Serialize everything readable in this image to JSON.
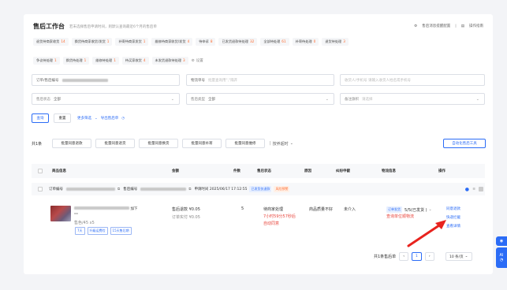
{
  "header": {
    "title": "售后工作台",
    "subtitle": "若未选择售后申请时间，则默认查询最近6个月的售后单",
    "link_config": "售后消息提醒配置",
    "link_guide": "操作指南"
  },
  "status_chips_row1": [
    {
      "label": "退货待商家收货",
      "count": "14"
    },
    {
      "label": "换货待商家收货/发货",
      "count": "1"
    },
    {
      "label": "补寄待商家发货",
      "count": "1"
    },
    {
      "label": "维修待商家收货/发货",
      "count": "4"
    },
    {
      "label": "待申诉",
      "count": "8"
    },
    {
      "label": "已发货退款待处理",
      "count": "32"
    },
    {
      "label": "全部待处理",
      "count": "61"
    },
    {
      "label": "补寄待处理",
      "count": "0"
    },
    {
      "label": "退货待处理",
      "count": "3"
    }
  ],
  "status_chips_row2": [
    {
      "label": "争议待处理",
      "count": "1"
    },
    {
      "label": "换货待处理",
      "count": "1"
    },
    {
      "label": "维修待处理",
      "count": "1"
    },
    {
      "label": "待买家收货",
      "count": "4"
    },
    {
      "label": "未发货退款待处理",
      "count": "3"
    }
  ],
  "settings_label": "设置",
  "filters": {
    "order_no_label": "订单/售后编号",
    "logistics_label": "物流单号",
    "logistics_placeholder": "批量查询用\",\"隔开",
    "buyer_placeholder": "收货人/手机号 请输入收货人姓名或手机号",
    "after_status_label": "售后状态",
    "after_status_value": "全部",
    "after_type_label": "售后类型",
    "after_type_value": "全部",
    "remark_label": "备注旗帜",
    "remark_value": "请选择"
  },
  "actions": {
    "search": "查询",
    "reset": "重置",
    "more_filters": "更多筛选",
    "export": "导出售后单"
  },
  "batch": {
    "total": "共1条",
    "btn1": "批量同意退款",
    "btn2": "批量同意退货",
    "btn3": "批量同意换货",
    "btn4": "批量同意补寄",
    "btn5": "批量同意维修",
    "sort": "按养超时",
    "auto_tool": "自动化售后工具"
  },
  "table_headers": {
    "goods": "商品信息",
    "amount": "金额",
    "qty": "件数",
    "status": "售后状态",
    "reason": "原因",
    "dispute": "纠纷申截",
    "logistics": "物流信息",
    "ops": "操作"
  },
  "order": {
    "order_no_label": "订单编号",
    "after_no_label": "售后编号",
    "apply_time": "申请时间 2025/06/17 17:12:55",
    "tag1": "已发货仅退款",
    "tag2": "风险预警",
    "goods_title_suffix": "加下",
    "goods_spec": "售色/45 x5",
    "goods_tag1": "7天",
    "goods_tag2": "升级运费险",
    "goods_tag3": "15天售后期",
    "refund_amount": "售后退款 ¥0.05",
    "order_amount": "订单实付 ¥0.05",
    "qty": "5",
    "status_main": "待商家处理",
    "status_countdown": "7小时59分57秒后",
    "status_auto": "自动同意",
    "reason": "商品质量不好",
    "dispute": "未介入",
    "logistics_tag": "订单发货",
    "logistics_progress": "5/5(已发货 )",
    "logistics_link": "查询单位顺物流",
    "op1": "同意退款",
    "op2": "快递拦截",
    "op3": "查看详情"
  },
  "pagination": {
    "total": "共1条售后单",
    "current": "1",
    "page_size": "10 条/页"
  },
  "float_btn": "AI"
}
